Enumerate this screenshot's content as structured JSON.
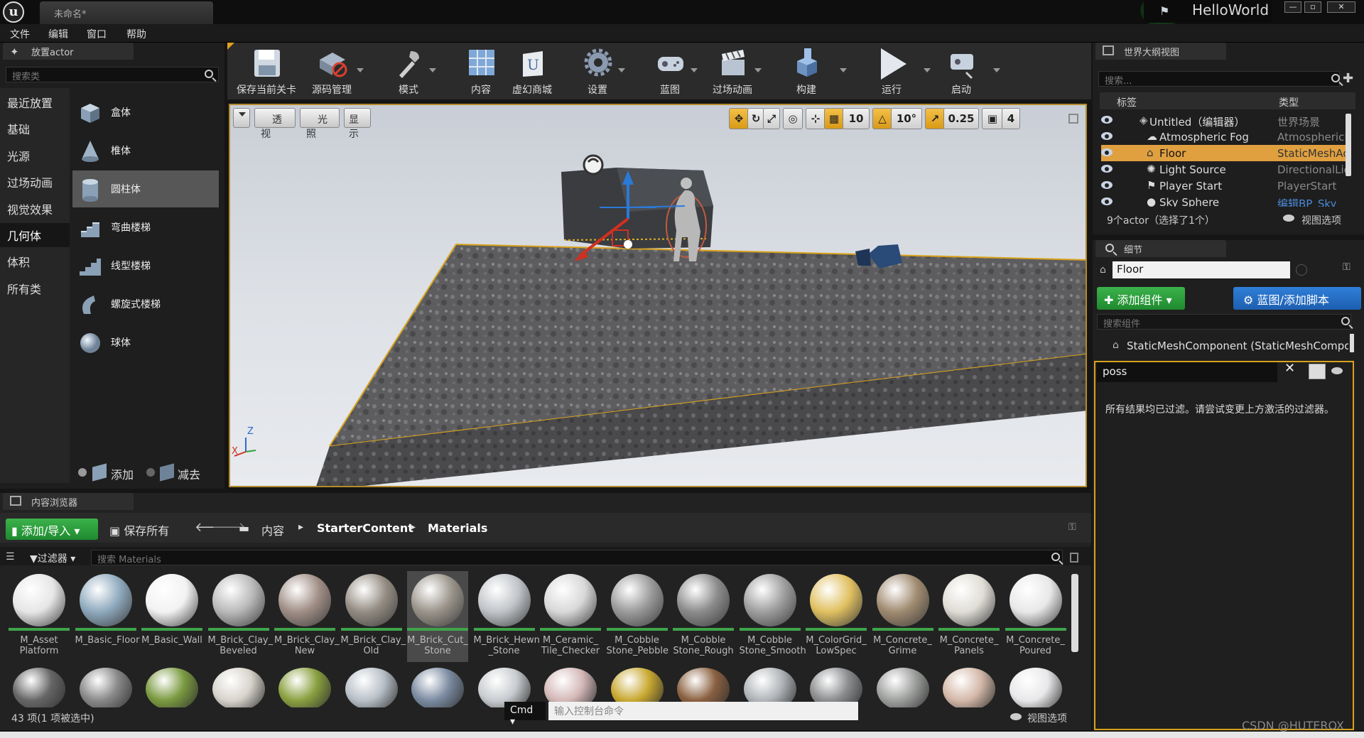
{
  "title": {
    "doc_tab": "未命名*",
    "app_badge": "HelloWorld",
    "buttons": [
      "—",
      "▫",
      "✕"
    ]
  },
  "menu": [
    "文件",
    "编辑",
    "窗口",
    "帮助"
  ],
  "place_actor": {
    "tab": "放置actor",
    "search_placeholder": "搜索类",
    "categories": [
      "最近放置",
      "基础",
      "光源",
      "过场动画",
      "视觉效果",
      "几何体",
      "体积",
      "所有类"
    ],
    "active_category": "几何体",
    "items": [
      "盒体",
      "椎体",
      "圆柱体",
      "弯曲楼梯",
      "线型楼梯",
      "螺旋式楼梯",
      "球体"
    ],
    "selected_item": "圆柱体",
    "footer": {
      "add": "添加",
      "subtract": "减去"
    }
  },
  "toolbar": {
    "buttons": [
      "保存当前关卡",
      "源码管理",
      "模式",
      "内容",
      "虚幻商城",
      "设置",
      "蓝图",
      "过场动画",
      "构建",
      "运行",
      "启动"
    ]
  },
  "viewport": {
    "left_buttons": {
      "perspective": "透视",
      "lit": "光照",
      "show": "显示"
    },
    "grid_snap": "10",
    "rotation_snap": "10°",
    "scale_snap": "0.25",
    "camera_speed": "4",
    "axis": {
      "z": "Z",
      "x": "X"
    }
  },
  "outliner": {
    "tab": "世界大纲视图",
    "search_placeholder": "搜索...",
    "col_label": "标签",
    "col_type": "类型",
    "rows": [
      {
        "name": "Untitled（编辑器）",
        "type": "世界场景"
      },
      {
        "name": "Atmospheric Fog",
        "type": "AtmosphericF"
      },
      {
        "name": "Floor",
        "type": "StaticMeshAc"
      },
      {
        "name": "Light Source",
        "type": "DirectionalLic"
      },
      {
        "name": "Player Start",
        "type": "PlayerStart"
      },
      {
        "name": "Sky Sphere",
        "type": "编辑BP_Sky"
      }
    ],
    "selected_row": "Floor",
    "footer": "9个actor（选择了1个）",
    "view_options": "视图选项"
  },
  "details": {
    "tab": "细节",
    "name_value": "Floor",
    "add_component": "添加组件",
    "blueprint_button": "蓝图/添加脚本",
    "search_components_placeholder": "搜索组件",
    "component": "StaticMeshComponent (StaticMeshCompon",
    "filter_value": "poss",
    "empty_message": "所有结果均已过滤。请尝试变更上方激活的过滤器。"
  },
  "content_browser": {
    "tab": "内容浏览器",
    "add_import": "添加/导入",
    "save_all": "保存所有",
    "breadcrumb": [
      "内容",
      "StarterContent",
      "Materials"
    ],
    "filters": "过滤器",
    "search_placeholder": "搜索 Materials",
    "assets": [
      {
        "name": "M_Asset Platform",
        "color": "#e6e6e6"
      },
      {
        "name": "M_Basic_Floor",
        "color": "#8ea9bd"
      },
      {
        "name": "M_Basic_Wall",
        "color": "#f2f2f2"
      },
      {
        "name": "M_Brick_Clay_ Beveled",
        "color": "#b9b9b9"
      },
      {
        "name": "M_Brick_Clay_ New",
        "color": "#a08e86"
      },
      {
        "name": "M_Brick_Clay_ Old",
        "color": "#948c83"
      },
      {
        "name": "M_Brick_Cut_ Stone",
        "color": "#9a948a"
      },
      {
        "name": "M_Brick_Hewn _Stone",
        "color": "#c0c4c8"
      },
      {
        "name": "M_Ceramic_ Tile_Checker",
        "color": "#d8d8d8"
      },
      {
        "name": "M_Cobble Stone_Pebble",
        "color": "#9a9a9a"
      },
      {
        "name": "M_Cobble Stone_Rough",
        "color": "#8b8b8b"
      },
      {
        "name": "M_Cobble Stone_Smooth",
        "color": "#9e9e9e"
      },
      {
        "name": "M_ColorGrid_ LowSpec",
        "color": "#e0c060"
      },
      {
        "name": "M_Concrete_ Grime",
        "color": "#a08a70"
      },
      {
        "name": "M_Concrete_ Panels",
        "color": "#e0ddd6"
      },
      {
        "name": "M_Concrete_ Poured",
        "color": "#e8e8e8"
      }
    ],
    "selected_asset": "M_Brick_Cut_ Stone",
    "count": "43 项(1 项被选中)",
    "cmd": "Cmd",
    "console_placeholder": "输入控制台命令",
    "view_options": "视图选项"
  },
  "watermark": "CSDN @HUTEROX"
}
